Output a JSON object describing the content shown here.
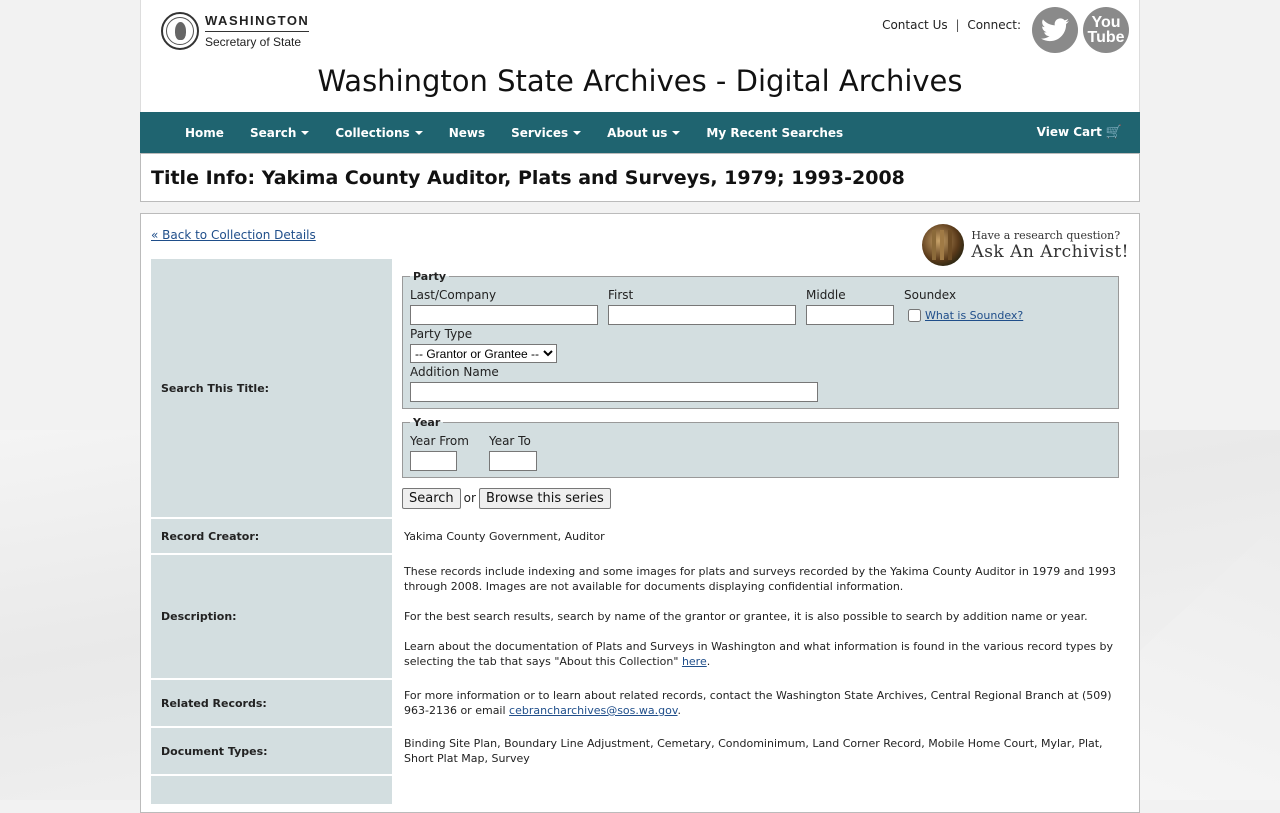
{
  "header": {
    "logo_line1": "WASHINGTON",
    "logo_line2": "Secretary of State",
    "contact_label": "Contact Us",
    "separator": "|",
    "connect_label": "Connect:",
    "youtube_text": "You Tube",
    "site_title": "Washington State Archives - Digital Archives"
  },
  "nav": {
    "items": [
      {
        "label": "Home"
      },
      {
        "label": "Search"
      },
      {
        "label": "Collections"
      },
      {
        "label": "News"
      },
      {
        "label": "Services"
      },
      {
        "label": "About us"
      },
      {
        "label": "My Recent Searches"
      }
    ],
    "cart_label": "View Cart",
    "cart_icon": "shopping-cart-icon"
  },
  "page": {
    "title": "Title Info: Yakima County Auditor, Plats and Surveys, 1979; 1993-2008",
    "back_link": "« Back to Collection Details",
    "ask_line1": "Have a research question?",
    "ask_line2": "Ask An Archivist!"
  },
  "search": {
    "row_label": "Search This Title:",
    "party_legend": "Party",
    "last_company_label": "Last/Company",
    "last_company_value": "",
    "first_label": "First",
    "first_value": "",
    "middle_label": "Middle",
    "middle_value": "",
    "soundex_label": "Soundex",
    "soundex_link": "What is Soundex?",
    "party_type_label": "Party Type",
    "party_type_selected": "-- Grantor or Grantee --",
    "addition_label": "Addition Name",
    "addition_value": "",
    "year_legend": "Year",
    "year_from_label": "Year From",
    "year_to_label": "Year To",
    "search_button": "Search",
    "or_text": "or",
    "browse_button": "Browse this series"
  },
  "details": {
    "creator_label": "Record Creator:",
    "creator_value": "Yakima County Government, Auditor",
    "description_label": "Description:",
    "description_p1": "These records include indexing and some images for plats and surveys recorded by the Yakima County Auditor in 1979 and 1993 through 2008. Images are not available for documents displaying confidential information.",
    "description_p2": "For the best search results, search by name of the grantor or grantee, it is also possible to search by addition name or year.",
    "description_p3_text": "Learn about the documentation of Plats and Surveys in Washington and what information is found in the various record types by selecting the tab that says \"About this Collection\" ",
    "description_p3_link": "here",
    "description_p3_end": ".",
    "related_label": "Related Records:",
    "related_text": "For more information or to learn about related records, contact the Washington State Archives, Central Regional Branch at (509) 963-2136 or email ",
    "related_email": "cebrancharchives@sos.wa.gov",
    "related_end": ".",
    "doctypes_label": "Document Types:",
    "doctypes_value": "Binding Site Plan, Boundary Line Adjustment, Cemetary, Condominimum, Land Corner Record, Mobile Home Court, Mylar, Plat, Short Plat Map, Survey"
  }
}
